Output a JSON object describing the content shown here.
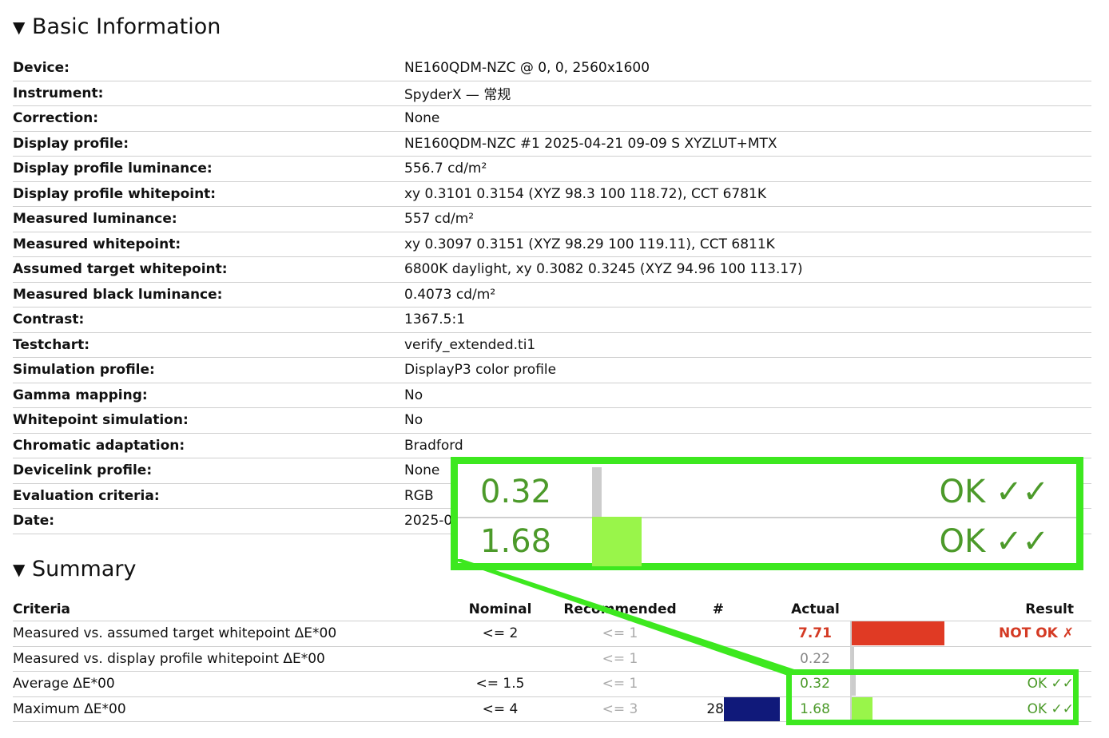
{
  "basic": {
    "title": "Basic Information",
    "rows": [
      {
        "key": "Device:",
        "value": "NE160QDM-NZC @ 0, 0, 2560x1600"
      },
      {
        "key": "Instrument:",
        "value": "SpyderX — 常规"
      },
      {
        "key": "Correction:",
        "value": "None"
      },
      {
        "key": "Display profile:",
        "value": "NE160QDM-NZC #1 2025-04-21 09-09 S XYZLUT+MTX"
      },
      {
        "key": "Display profile luminance:",
        "value": "556.7 cd/m²"
      },
      {
        "key": "Display profile whitepoint:",
        "value": "xy 0.3101 0.3154 (XYZ 98.3 100 118.72), CCT 6781K"
      },
      {
        "key": "Measured luminance:",
        "value": "557 cd/m²"
      },
      {
        "key": "Measured whitepoint:",
        "value": "xy 0.3097 0.3151 (XYZ 98.29 100 119.11), CCT 6811K"
      },
      {
        "key": "Assumed target whitepoint:",
        "value": "6800K daylight, xy 0.3082 0.3245 (XYZ 94.96 100 113.17)"
      },
      {
        "key": "Measured black luminance:",
        "value": "0.4073 cd/m²"
      },
      {
        "key": "Contrast:",
        "value": "1367.5:1"
      },
      {
        "key": "Testchart:",
        "value": "verify_extended.ti1"
      },
      {
        "key": "Simulation profile:",
        "value": "DisplayP3 color profile"
      },
      {
        "key": "Gamma mapping:",
        "value": "No"
      },
      {
        "key": "Whitepoint simulation:",
        "value": "No"
      },
      {
        "key": "Chromatic adaptation:",
        "value": "Bradford"
      },
      {
        "key": "Devicelink profile:",
        "value": "None"
      },
      {
        "key": "Evaluation criteria:",
        "value": "RGB"
      },
      {
        "key": "Date:",
        "value": "2025-0"
      }
    ]
  },
  "summary": {
    "title": "Summary",
    "headers": {
      "criteria": "Criteria",
      "nominal": "Nominal",
      "recommended": "Recommended",
      "count": "#",
      "actual": "Actual",
      "result": "Result"
    },
    "rows": [
      {
        "criteria": "Measured vs. assumed target whitepoint ΔE*00",
        "nominal": "<= 2",
        "recommended": "<= 1",
        "count": "",
        "actual": "7.71",
        "result": "NOT OK ✗",
        "status": "bad",
        "bar_color": "#e03a24",
        "bar_fraction": 1.0,
        "count_bar_fraction": 0
      },
      {
        "criteria": "Measured vs. display profile whitepoint ΔE*00",
        "nominal": "",
        "recommended": "<= 1",
        "count": "",
        "actual": "0.22",
        "result": "",
        "status": "muted",
        "bar_color": "#cccccc",
        "bar_fraction": 0.03,
        "count_bar_fraction": 0
      },
      {
        "criteria": "Average ΔE*00",
        "nominal": "<= 1.5",
        "recommended": "<= 1",
        "count": "",
        "actual": "0.32",
        "result": "OK ✓✓",
        "status": "ok",
        "bar_color": "#cccccc",
        "bar_fraction": 0.04,
        "count_bar_fraction": 0
      },
      {
        "criteria": "Maximum ΔE*00",
        "nominal": "<= 4",
        "recommended": "<= 3",
        "count": "28",
        "actual": "1.68",
        "result": "OK ✓✓",
        "status": "ok",
        "bar_color": "#99f54a",
        "bar_fraction": 0.22,
        "count_bar_fraction": 1.0
      }
    ]
  },
  "zoom": {
    "rows": [
      {
        "actual": "0.32",
        "result": "OK ✓✓",
        "bar_color": "#cccccc",
        "bar_fraction": 0.04
      },
      {
        "actual": "1.68",
        "result": "OK ✓✓",
        "bar_color": "#99f54a",
        "bar_fraction": 0.22
      }
    ],
    "highlight_color": "#3de81f",
    "count_bar_color": "#10197a"
  }
}
